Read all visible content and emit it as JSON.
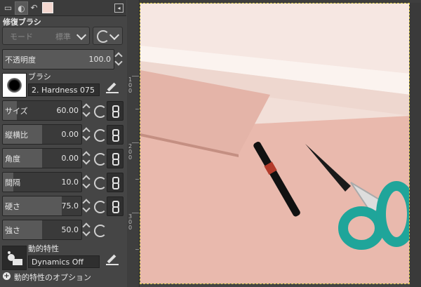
{
  "tool_options": {
    "tool_title": "修復ブラシ",
    "mode": {
      "label": "モード",
      "value": "標準"
    },
    "opacity": {
      "label": "不透明度",
      "value": "100.0",
      "level": 1.0
    },
    "brush": {
      "section_label": "ブラシ",
      "name": "2. Hardness 075"
    },
    "size": {
      "label": "サイズ",
      "value": "60.00",
      "level": 0.06
    },
    "aspect_ratio": {
      "label": "縦横比",
      "value": "0.00",
      "level": 0.5
    },
    "angle": {
      "label": "角度",
      "value": "0.00",
      "level": 0.5
    },
    "spacing": {
      "label": "間隔",
      "value": "10.0",
      "level": 0.1
    },
    "hardness": {
      "label": "硬さ",
      "value": "75.0",
      "level": 0.75
    },
    "force": {
      "label": "強さ",
      "value": "50.0",
      "level": 0.5
    },
    "dynamics": {
      "section_label": "動的特性",
      "name": "Dynamics Off"
    },
    "dynamics_options": {
      "label": "動的特性のオプション"
    }
  },
  "icons": {
    "tab1": "device-status-icon",
    "tab2": "paint-dynamics-icon",
    "tab3": "undo-history-icon",
    "tab4": "color-swatch-icon",
    "panel_menu": "panel-menu-icon",
    "reset": "reset-icon",
    "chain": "chain-link-icon",
    "edit": "edit-icon"
  },
  "ruler": {
    "labels": [
      "1 0 0",
      "2 0 0",
      "3 0 0"
    ]
  },
  "colors": {
    "panel_bg": "#454545",
    "swatch_fg": "#f4d8d0",
    "canvas_border": "#d8c845"
  }
}
